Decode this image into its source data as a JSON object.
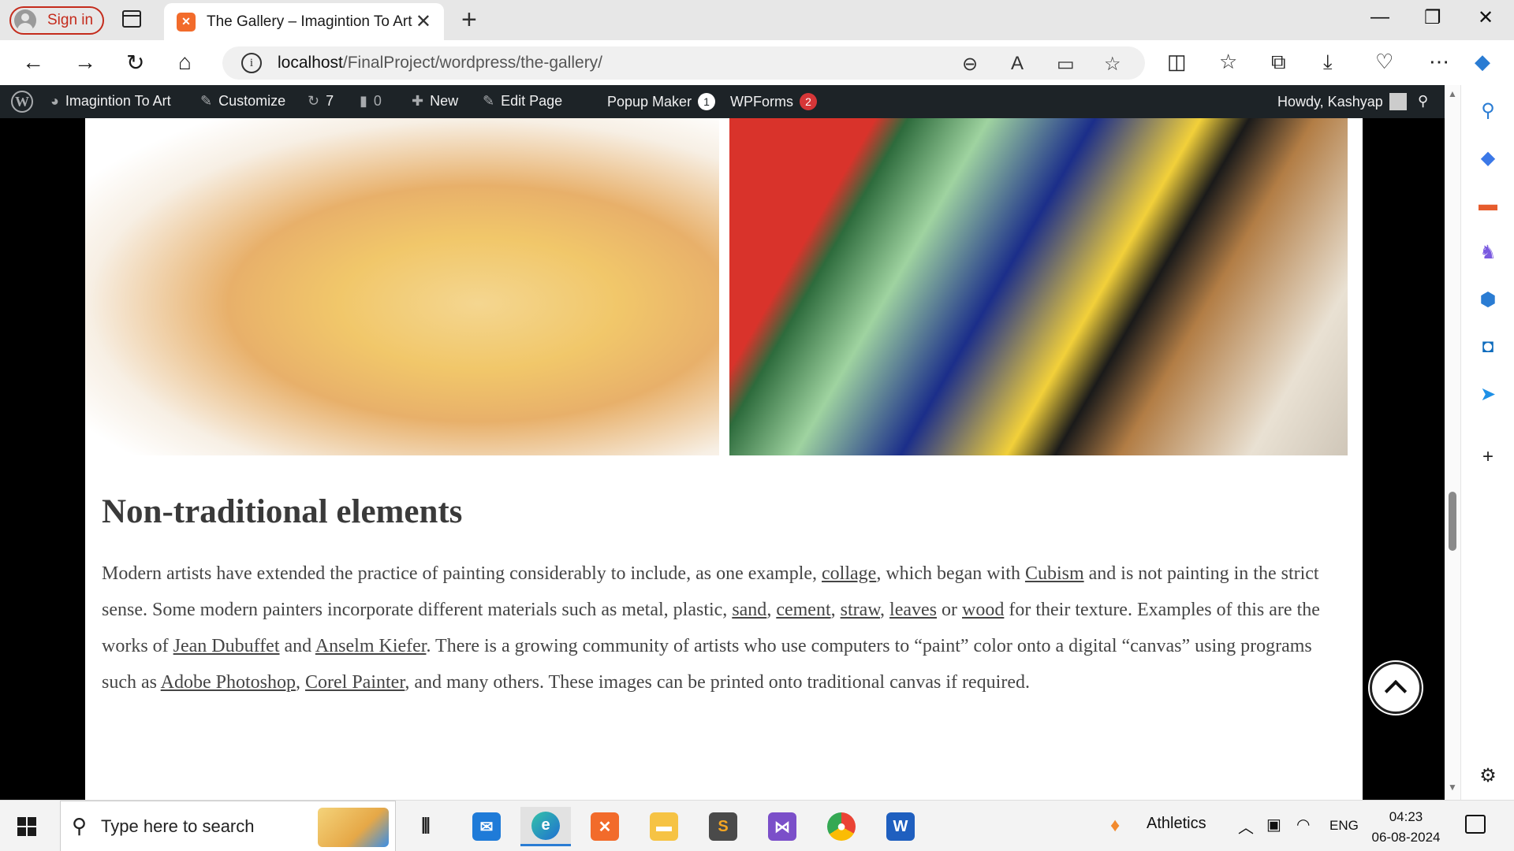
{
  "browser": {
    "signin_label": "Sign in",
    "tab_title": "The Gallery – Imagintion To Art",
    "url_host": "localhost",
    "url_path": "/FinalProject/wordpress/the-gallery/"
  },
  "wpadmin": {
    "site_name": "Imagintion To Art",
    "customize": "Customize",
    "updates_count": "7",
    "comments_count": "0",
    "new_label": "New",
    "edit_page": "Edit Page",
    "popup_maker": "Popup Maker",
    "popup_badge": "1",
    "wpforms": "WPForms",
    "wpforms_badge": "2",
    "howdy": "Howdy, Kashyap"
  },
  "article": {
    "heading": "Non-traditional elements",
    "para": {
      "t1": "Modern artists have extended the practice of painting considerably to include, as one example, ",
      "l1": "collage",
      "t2": ", which began with ",
      "l2": "Cubism",
      "t3": " and is not painting in the strict sense. Some modern painters incorporate different materials such as metal, plastic, ",
      "l3": "sand",
      "t4": ", ",
      "l4": "cement",
      "t5": ", ",
      "l5": "straw",
      "t6": ", ",
      "l6": "leaves",
      "t7": " or ",
      "l7": "wood",
      "t8": " for their texture. Examples of this are the works of ",
      "l8": "Jean Dubuffet",
      "t9": " and ",
      "l9": "Anselm Kiefer",
      "t10": ". There is a growing community of artists who use computers to “paint” color onto a digital “canvas” using programs such as ",
      "l10": "Adobe Photoshop",
      "t11": ", ",
      "l11": "Corel Painter",
      "t12": ", and many others. These images can be printed onto traditional canvas if required."
    }
  },
  "taskbar": {
    "search_placeholder": "Type here to search",
    "weather": "Athletics",
    "lang": "ENG",
    "time": "04:23",
    "date": "06-08-2024"
  },
  "colors": {
    "wp_bar": "#1d2327",
    "accent_red": "#d63638",
    "edge_blue": "#2a7cd3"
  }
}
